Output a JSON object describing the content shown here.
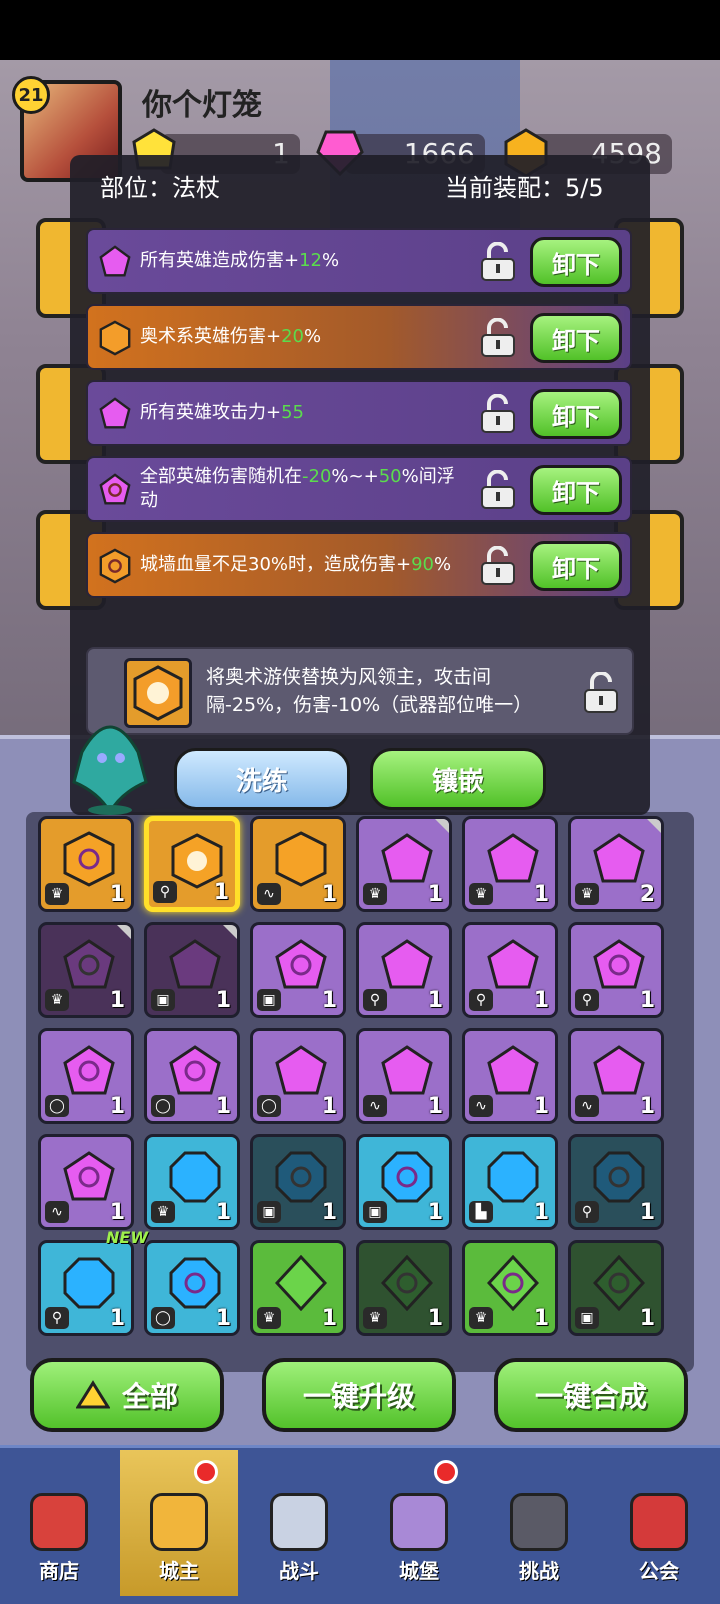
{
  "player": {
    "name": "你个灯笼",
    "level": "21"
  },
  "resources": [
    {
      "icon": "yellow-gem-icon",
      "value": "1"
    },
    {
      "icon": "pink-crystal-icon",
      "value": "1666"
    },
    {
      "icon": "gold-coin-icon",
      "value": "4598"
    }
  ],
  "popup": {
    "slot_label": "部位：法杖",
    "equip_label": "当前装配：5/5",
    "affixes": [
      {
        "style": "purple",
        "icon": "purple-pentagon-gem-icon",
        "pre": "所有英雄造成伤害+",
        "val": "12",
        "post": "%",
        "button": "卸下"
      },
      {
        "style": "orange",
        "icon": "orange-hexagon-gem-icon",
        "pre": "奥术系英雄伤害+",
        "val": "20",
        "post": "%",
        "button": "卸下"
      },
      {
        "style": "purple",
        "icon": "purple-pentagon-gem-icon",
        "pre": "所有英雄攻击力+",
        "val": "55",
        "post": "",
        "button": "卸下"
      },
      {
        "style": "purple",
        "icon": "purple-swirl-gem-icon",
        "pre": "全部英雄伤害随机在",
        "val": "-20",
        "mid": "%~+",
        "val2": "50",
        "post": "%间浮动",
        "button": "卸下"
      },
      {
        "style": "orange",
        "icon": "orange-swirl-gem-icon",
        "pre": "城墙血量不足30%时，造成伤害+",
        "val": "90",
        "post": "%",
        "button": "卸下"
      }
    ],
    "special": "将奥术游侠替换为风领主，攻击间隔-25%，伤害-10%（武器部位唯一）",
    "wash_button": "洗练",
    "inlay_button": "镶嵌"
  },
  "grid": [
    {
      "bg": "orange",
      "gem": "hex-swirl",
      "tag": "♛",
      "count": "1"
    },
    {
      "bg": "orange",
      "gem": "hex-star",
      "tag": "⚲",
      "count": "1",
      "selected": true
    },
    {
      "bg": "orange",
      "gem": "hex",
      "tag": "∿",
      "count": "1"
    },
    {
      "bg": "purple",
      "gem": "pent",
      "tag": "♛",
      "count": "1",
      "corner": true
    },
    {
      "bg": "purple",
      "gem": "pent",
      "tag": "♛",
      "count": "1"
    },
    {
      "bg": "purple",
      "gem": "pent",
      "tag": "♛",
      "count": "2",
      "corner": true
    },
    {
      "bg": "dpurple",
      "gem": "pent-swirl",
      "tag": "♛",
      "count": "1",
      "corner": true
    },
    {
      "bg": "dpurple",
      "gem": "pent",
      "tag": "▣",
      "count": "1",
      "corner": true
    },
    {
      "bg": "purple",
      "gem": "pent-swirl",
      "tag": "▣",
      "count": "1"
    },
    {
      "bg": "purple",
      "gem": "pent",
      "tag": "⚲",
      "count": "1"
    },
    {
      "bg": "purple",
      "gem": "pent",
      "tag": "⚲",
      "count": "1"
    },
    {
      "bg": "purple",
      "gem": "pent-swirl",
      "tag": "⚲",
      "count": "1"
    },
    {
      "bg": "purple",
      "gem": "pent-swirl",
      "tag": "◯",
      "count": "1"
    },
    {
      "bg": "purple",
      "gem": "pent-swirl",
      "tag": "◯",
      "count": "1"
    },
    {
      "bg": "purple",
      "gem": "pent",
      "tag": "◯",
      "count": "1"
    },
    {
      "bg": "purple",
      "gem": "pent",
      "tag": "∿",
      "count": "1"
    },
    {
      "bg": "purple",
      "gem": "pent",
      "tag": "∿",
      "count": "1"
    },
    {
      "bg": "purple",
      "gem": "pent",
      "tag": "∿",
      "count": "1"
    },
    {
      "bg": "purple",
      "gem": "pent-swirl",
      "tag": "∿",
      "count": "1"
    },
    {
      "bg": "blue",
      "gem": "oct",
      "tag": "♛",
      "count": "1"
    },
    {
      "bg": "dblue",
      "gem": "oct-swirl",
      "tag": "▣",
      "count": "1"
    },
    {
      "bg": "blue",
      "gem": "oct-swirl",
      "tag": "▣",
      "count": "1"
    },
    {
      "bg": "blue",
      "gem": "oct",
      "tag": "▙",
      "count": "1"
    },
    {
      "bg": "dblue",
      "gem": "oct-swirl",
      "tag": "⚲",
      "count": "1"
    },
    {
      "bg": "blue",
      "gem": "oct",
      "tag": "⚲",
      "count": "1",
      "new": "NEW"
    },
    {
      "bg": "blue",
      "gem": "oct-swirl",
      "tag": "◯",
      "count": "1"
    },
    {
      "bg": "green",
      "gem": "dia",
      "tag": "♛",
      "count": "1"
    },
    {
      "bg": "dgreen",
      "gem": "dia-swirl",
      "tag": "♛",
      "count": "1"
    },
    {
      "bg": "green",
      "gem": "dia-swirl",
      "tag": "♛",
      "count": "1"
    },
    {
      "bg": "dgreen",
      "gem": "dia-swirl",
      "tag": "▣",
      "count": "1"
    }
  ],
  "actions": {
    "all": "全部",
    "upgrade": "一键升级",
    "compose": "一键合成"
  },
  "nav": [
    {
      "label": "商店",
      "icon": "shop-icon",
      "color": "#d8423c"
    },
    {
      "label": "城主",
      "icon": "crown-icon",
      "color": "#f1b53b",
      "active": true,
      "dot": true
    },
    {
      "label": "战斗",
      "icon": "crossed-swords-icon",
      "color": "#c9d2e3"
    },
    {
      "label": "城堡",
      "icon": "castle-icon",
      "color": "#a889d6",
      "dot": true
    },
    {
      "label": "挑战",
      "icon": "demon-mask-icon",
      "color": "#5a5a66"
    },
    {
      "label": "公会",
      "icon": "guild-banner-icon",
      "color": "#d43a3a"
    }
  ],
  "colors": {
    "green_value": "#5bdc4d",
    "select": "#ffe02a",
    "button_green": "#53c22b"
  }
}
